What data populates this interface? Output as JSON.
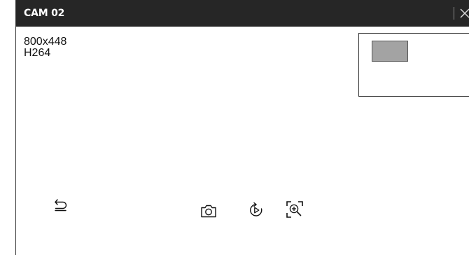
{
  "window": {
    "title": "CAM 02"
  },
  "video_info": {
    "resolution": "800x448",
    "codec": "H264"
  },
  "colors": {
    "titlebar_bg": "#262626",
    "minimap_view": "#a3a3a3"
  },
  "icons": {
    "close": "close-icon",
    "back": "back-arrow-icon",
    "snapshot": "camera-icon",
    "instant_playback": "instant-playback-icon",
    "zoom": "zoom-in-icon"
  }
}
